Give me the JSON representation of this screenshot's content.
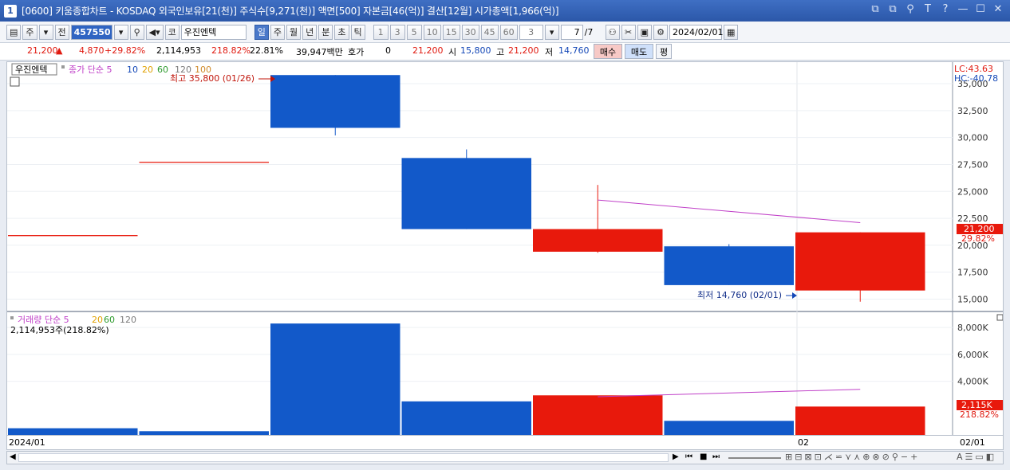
{
  "window": {
    "number": "1",
    "title": "[0600] 키움종합차트 - KOSDAQ 외국인보유[21(천)] 주식수[9,271(천)] 액면[500] 자본금[46(억)] 결산[12월] 시가총액[1,966(억)]",
    "controls": [
      "⧉",
      "⧉",
      "⚲",
      "T",
      "?",
      "—",
      "☐",
      "✕"
    ]
  },
  "toolbar": {
    "period_label": "주",
    "prev_label": "전",
    "stock_code": "457550",
    "market_label": "코",
    "stock_name": "우진엔텍",
    "period_tabs": [
      "일",
      "주",
      "월",
      "년",
      "분",
      "초",
      "틱"
    ],
    "active_tab": "일",
    "intervals": [
      "1",
      "3",
      "5",
      "10",
      "15",
      "30",
      "45",
      "60"
    ],
    "interval_value": "3",
    "page_current": "7",
    "page_total": "/7",
    "date": "2024/02/01"
  },
  "quote": {
    "price": "21,200",
    "change": "4,870",
    "change_pct": "+29.82%",
    "volume": "2,114,953",
    "volume_ratio": "218.82%",
    "turnover": "22.81%",
    "amount": "39,947백만",
    "hoga_label": "호가",
    "hoga_value": "0",
    "current": "21,200",
    "open_label": "시",
    "open": "15,800",
    "high_label": "고",
    "high": "21,200",
    "low_label": "저",
    "low": "14,760",
    "buy_label": "매수",
    "sell_label": "매도",
    "eval_label": "평"
  },
  "colors": {
    "up": "#e8190c",
    "down": "#1259c9",
    "ma": "#c040c8"
  },
  "price_panel": {
    "stock_tag": "우진엔텍",
    "legend_main": "종가 단순 5",
    "legend_periods": [
      {
        "label": "10",
        "color": "#1347b7"
      },
      {
        "label": "20",
        "color": "#e0a000"
      },
      {
        "label": "60",
        "color": "#2c9a2c"
      },
      {
        "label": "120",
        "color": "#7b7b7b"
      },
      {
        "label": "100",
        "color": "#d08a2a"
      }
    ],
    "max_note": "최고 35,800 (01/26)",
    "min_note": "최저 14,760 (02/01)",
    "lc": "LC:43.63",
    "hc": "HC:-40.78",
    "current_price_label": "21,200",
    "current_pct_label": "29.82%",
    "yticks": [
      "35,000",
      "32,500",
      "30,000",
      "27,500",
      "25,000",
      "22,500",
      "20,000",
      "17,500",
      "15,000"
    ]
  },
  "volume_panel": {
    "legend_main": "거래량 단순 5",
    "legend_periods": [
      {
        "label": "20",
        "color": "#e0a000"
      },
      {
        "label": "60",
        "color": "#2c9a2c"
      },
      {
        "label": "120",
        "color": "#7b7b7b"
      }
    ],
    "value_note": "2,114,953주(218.82%)",
    "current_label": "2,115K",
    "current_pct_label": "218.82%",
    "yticks": [
      "8,000K",
      "6,000K",
      "4,000K"
    ]
  },
  "x_labels": {
    "start": "2024/01",
    "mid": "02",
    "right": "02/01"
  },
  "chart_data": {
    "type": "candlestick",
    "candles": [
      {
        "open": 20900,
        "close": 20900,
        "high": 20900,
        "low": 20900,
        "volume": 500000,
        "dir": "flat"
      },
      {
        "open": 27700,
        "close": 27700,
        "high": 27700,
        "low": 27700,
        "volume": 280000,
        "dir": "flat"
      },
      {
        "open": 35800,
        "close": 30900,
        "high": 35800,
        "low": 30200,
        "volume": 8300000,
        "dir": "down"
      },
      {
        "open": 28100,
        "close": 21500,
        "high": 28900,
        "low": 21500,
        "volume": 2500000,
        "dir": "down"
      },
      {
        "open": 21500,
        "close": 19400,
        "high": 25600,
        "low": 19300,
        "volume": 2950000,
        "dir": "up"
      },
      {
        "open": 19900,
        "close": 16300,
        "high": 20100,
        "low": 16300,
        "volume": 1050000,
        "dir": "down"
      },
      {
        "open": 15800,
        "close": 21200,
        "high": 21200,
        "low": 14760,
        "volume": 2114953,
        "dir": "up"
      }
    ],
    "ma5_price": [
      null,
      null,
      null,
      null,
      24200,
      null,
      22100
    ],
    "ma5_volume": [
      null,
      null,
      null,
      null,
      2850000,
      null,
      3400000
    ],
    "price_range": [
      14000,
      37000
    ],
    "volume_range": [
      0,
      8900000
    ]
  }
}
